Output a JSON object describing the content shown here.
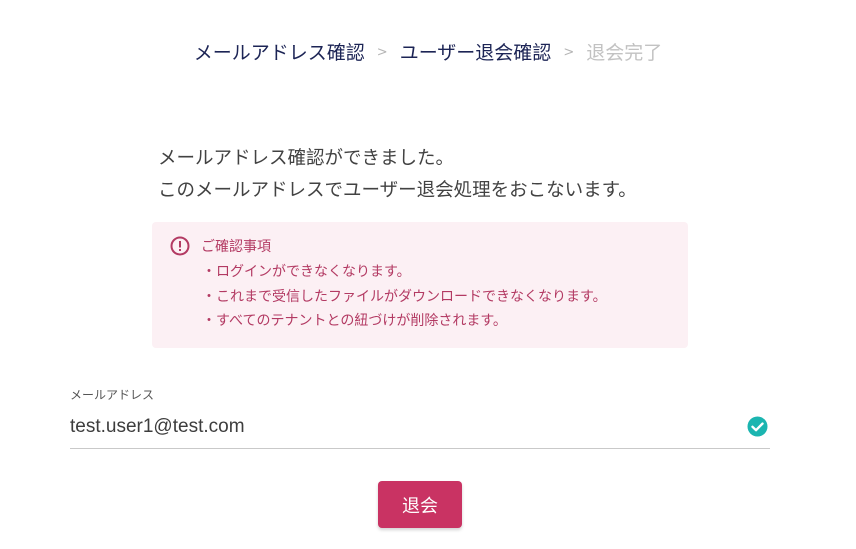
{
  "stepper": {
    "steps": [
      {
        "label": "メールアドレス確認",
        "state": "done"
      },
      {
        "label": "ユーザー退会確認",
        "state": "current"
      },
      {
        "label": "退会完了",
        "state": "pending"
      }
    ],
    "separator": ">"
  },
  "message": {
    "line1": "メールアドレス確認ができました。",
    "line2": "このメールアドレスでユーザー退会処理をおこないます。"
  },
  "notice": {
    "icon": "alert-circle-icon",
    "title": "ご確認事項",
    "items": [
      "ログインができなくなります。",
      "これまで受信したファイルがダウンロードできなくなります。",
      "すべてのテナントとの紐づけが削除されます。"
    ]
  },
  "email_field": {
    "label": "メールアドレス",
    "value": "test.user1@test.com",
    "status_icon": "check-circle-icon"
  },
  "submit": {
    "label": "退会"
  },
  "colors": {
    "step_active": "#1c2455",
    "step_pending": "#c2c2c2",
    "notice_bg": "#fcf0f4",
    "notice_text": "#b33a63",
    "check": "#1bb5b0",
    "button": "#c93363"
  }
}
